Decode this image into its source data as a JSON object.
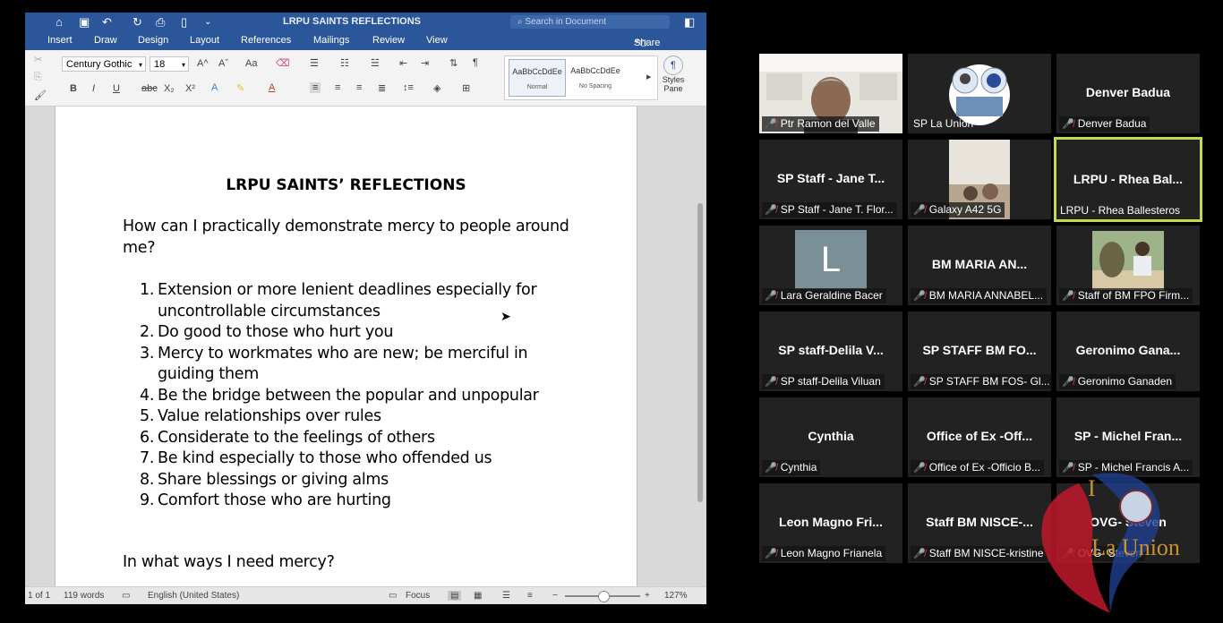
{
  "word": {
    "doc_title": "LRPU SAINTS REFLECTIONS",
    "search_placeholder": "Search in Document",
    "share_label": "Share",
    "tabs": [
      "Insert",
      "Draw",
      "Design",
      "Layout",
      "References",
      "Mailings",
      "Review",
      "View"
    ],
    "font_name": "Century Gothic",
    "font_size": "18",
    "styles": [
      {
        "preview": "AaBbCcDdEe",
        "name": "Normal"
      },
      {
        "preview": "AaBbCcDdEe",
        "name": "No Spacing"
      }
    ],
    "styles_pane_label": "Styles Pane",
    "document": {
      "heading": "LRPU SAINTS’ REFLECTIONS",
      "question1": "How can I practically demonstrate mercy to people around me?",
      "items": [
        "Extension or more lenient deadlines especially for uncontrollable circumstances",
        "Do good to those who hurt you",
        "Mercy to workmates who are new; be merciful in guiding them",
        "Be the bridge between the popular and unpopular",
        "Value relationships over rules",
        "Considerate to the feelings of others",
        "Be kind especially to those who offended us",
        "Share blessings or giving alms",
        "Comfort those who are hurting"
      ],
      "question2": "In what ways I need mercy?"
    },
    "status": {
      "page": "1 of 1",
      "words": "119 words",
      "language": "English (United States)",
      "focus": "Focus",
      "zoom": "127%"
    }
  },
  "participants": [
    {
      "name": "",
      "label": "Ptr Ramon del Valle",
      "video": "person"
    },
    {
      "name": "",
      "label": "SP La Union",
      "video": "logo"
    },
    {
      "name": "Denver Badua",
      "label": "Denver Badua"
    },
    {
      "name": "SP Staff - Jane T...",
      "label": "SP Staff - Jane T. Flor..."
    },
    {
      "name": "",
      "label": "Galaxy A42 5G",
      "video": "room"
    },
    {
      "name": "LRPU - Rhea Bal...",
      "label": "LRPU - Rhea Ballesteros",
      "active": true
    },
    {
      "name": "",
      "label": "Lara Geraldine Bacer",
      "video": "avatar",
      "initial": "L"
    },
    {
      "name": "BM MARIA AN...",
      "label": "BM MARIA ANNABEL..."
    },
    {
      "name": "",
      "label": "Staff of BM FPO Firm...",
      "video": "outdoor"
    },
    {
      "name": "SP staff-Delila V...",
      "label": "SP staff-Delila Viluan"
    },
    {
      "name": "SP STAFF BM FO...",
      "label": "SP STAFF BM FOS- Gl..."
    },
    {
      "name": "Geronimo Gana...",
      "label": "Geronimo Ganaden"
    },
    {
      "name": "Cynthia",
      "label": "Cynthia"
    },
    {
      "name": "Office of Ex -Off...",
      "label": "Office of Ex -Officio B..."
    },
    {
      "name": "SP - Michel Fran...",
      "label": "SP - Michel Francis A..."
    },
    {
      "name": "Leon Magno Fri...",
      "label": "Leon Magno Frianela"
    },
    {
      "name": "Staff BM NISCE-...",
      "label": "Staff BM NISCE-kristine"
    },
    {
      "name": "OVG- Steven",
      "label": "OVG- Steven"
    }
  ],
  "watermark": {
    "text": "La Union"
  },
  "colors": {
    "word_blue": "#2b579a",
    "active_border": "#c4d84c",
    "muted_mic": "#e03c3c"
  }
}
